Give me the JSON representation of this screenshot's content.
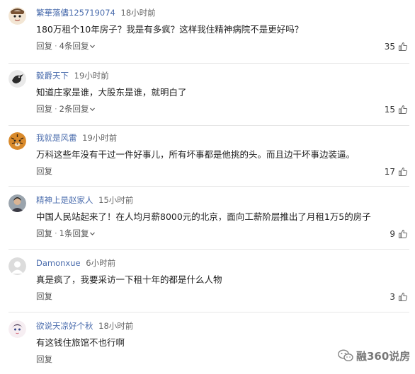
{
  "comments": [
    {
      "username": "繁華落儘125719074",
      "time": "18小时前",
      "text": "180万租个10年房子？我是有多疯？这样我住精神病院不是更好吗？",
      "reply_label": "回复",
      "replies_label": "4条回复",
      "likes": "35",
      "avatar": "cartoon-face-avatar"
    },
    {
      "username": "毅爵天下",
      "time": "19小时前",
      "text": "知道庄家是谁，大股东是谁，就明白了",
      "reply_label": "回复",
      "replies_label": "2条回复",
      "likes": "15",
      "avatar": "bird-avatar"
    },
    {
      "username": "我就是风雷",
      "time": "19小时前",
      "text": "万科这些年没有干过一件好事儿，所有坏事都是他挑的头。而且边干坏事边装逼。",
      "reply_label": "回复",
      "likes": "17",
      "avatar": "tiger-avatar"
    },
    {
      "username": "精神上是赵家人",
      "time": "15小时前",
      "text": "中国人民站起来了！在人均月薪8000元的北京，面向工薪阶层推出了月租1万5的房子",
      "reply_label": "回复",
      "replies_label": "1条回复",
      "likes": "9",
      "avatar": "man-portrait-avatar"
    },
    {
      "username": "Damonxue",
      "time": "6小时前",
      "text": "真是疯了，我要采访一下租十年的都是什么人物",
      "reply_label": "回复",
      "likes": "3",
      "avatar": "default-avatar"
    },
    {
      "username": "欲说天凉好个秋",
      "time": "18小时前",
      "text": "有这钱住旅馆不也行啊",
      "reply_label": "回复",
      "avatar": "anime-avatar"
    }
  ],
  "watermark": {
    "text": "融360说房",
    "icon": "wechat-icon"
  },
  "colors": {
    "username": "#4a6cad",
    "text": "#222222",
    "meta": "#666666",
    "divider": "#e6e6e6"
  }
}
